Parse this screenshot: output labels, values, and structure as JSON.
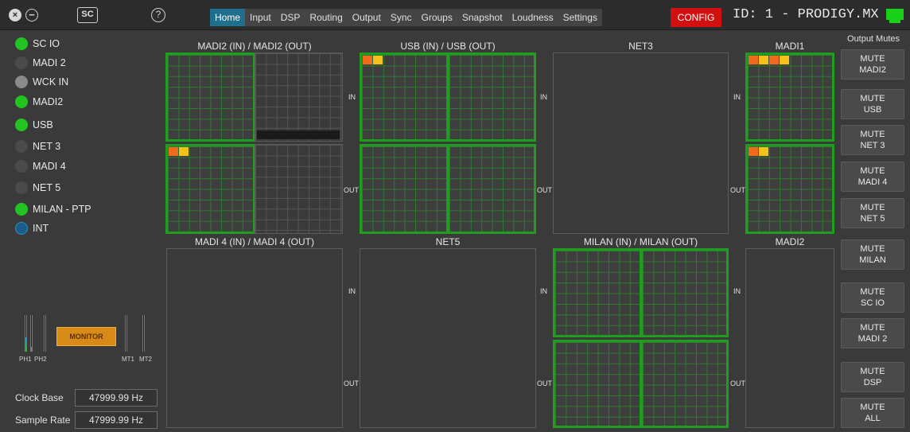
{
  "window": {
    "close_glyph": "×",
    "min_glyph": "−",
    "sc_label": "SC",
    "help_glyph": "?"
  },
  "tabs": [
    "Home",
    "Input",
    "DSP",
    "Routing",
    "Output",
    "Sync",
    "Groups",
    "Snapshot",
    "Loudness",
    "Settings"
  ],
  "active_tab": "Home",
  "config_label": "CONFIG",
  "device_id": "ID: 1 - PRODIGY.MX",
  "status_led_color": "#19d019",
  "sources": [
    {
      "label": "SC IO",
      "state": "on"
    },
    {
      "label": "MADI 2",
      "state": "off"
    },
    {
      "label": "WCK IN",
      "state": "grey"
    },
    {
      "label": "MADI2",
      "state": "on"
    },
    {
      "label": "USB",
      "state": "on"
    },
    {
      "label": "NET 3",
      "state": "off"
    },
    {
      "label": "MADI 4",
      "state": "off"
    },
    {
      "label": "NET 5",
      "state": "off"
    },
    {
      "label": "MILAN - PTP",
      "state": "on"
    },
    {
      "label": "INT",
      "state": "blue"
    }
  ],
  "monitor": {
    "label": "MONITOR",
    "ph1": "PH1",
    "ph2": "PH2",
    "mt1": "MT1",
    "mt2": "MT2"
  },
  "clock": {
    "base_label": "Clock Base",
    "base_value": "47999.99 Hz",
    "rate_label": "Sample Rate",
    "rate_value": "47999.99 Hz"
  },
  "sections": {
    "madi2": "MADI2 (IN) / MADI2 (OUT)",
    "usb": "USB (IN) / USB (OUT)",
    "net3": "NET3",
    "madi1": "MADI1",
    "madi4": "MADI 4 (IN) / MADI 4 (OUT)",
    "net5": "NET5",
    "milan": "MILAN (IN) / MILAN (OUT)",
    "madi2b": "MADI2"
  },
  "io": {
    "in": "IN",
    "out": "OUT"
  },
  "output_mutes": {
    "title": "Output Mutes",
    "buttons": [
      "MUTE\nMADI2",
      "MUTE\nUSB",
      "MUTE\nNET 3",
      "MUTE\nMADI 4",
      "MUTE\nNET 5",
      "MUTE\nMILAN",
      "MUTE\nSC IO",
      "MUTE\nMADI 2",
      "MUTE\nDSP",
      "MUTE\nALL"
    ]
  },
  "colors": {
    "active": "#1f9d1f",
    "config": "#d21010",
    "routed_orange": "#f26a1b",
    "routed_yellow": "#f2c21b"
  }
}
